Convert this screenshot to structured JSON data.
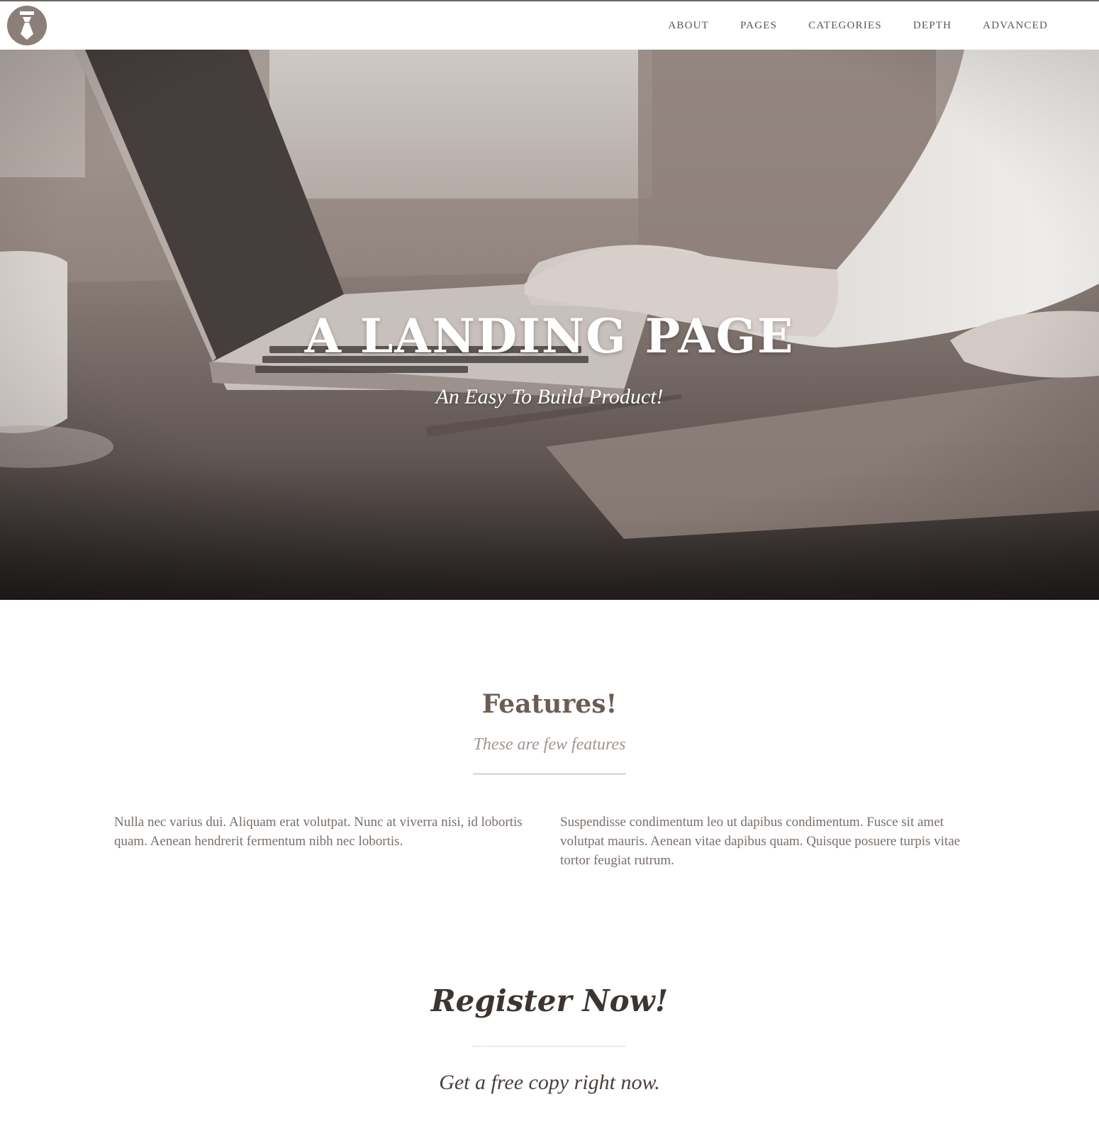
{
  "nav": {
    "logo_icon": "tie-icon",
    "items": [
      "ABOUT",
      "PAGES",
      "CATEGORIES",
      "DEPTH",
      "ADVANCED"
    ]
  },
  "hero": {
    "title": "A LANDING PAGE",
    "subtitle": "An Easy To Build Product!"
  },
  "features": {
    "title": "Features!",
    "subtitle": "These are few features",
    "items": [
      "Nulla nec varius dui. Aliquam erat volutpat. Nunc at viverra nisi, id lobortis quam. Aenean hendrerit fermentum nibh nec lobortis.",
      "Suspendisse condimentum leo ut dapibus condimentum. Fusce sit amet volutpat mauris. Aenean vitae dapibus quam. Quisque posuere turpis vitae tortor feugiat rutrum."
    ]
  },
  "register": {
    "title": "Register Now!",
    "subtitle": "Get a free copy right now."
  },
  "colors": {
    "accent": "#8c7e78",
    "heading": "#6b5c55",
    "text": "#7a6e69",
    "hero_dark": "#231f1e"
  }
}
